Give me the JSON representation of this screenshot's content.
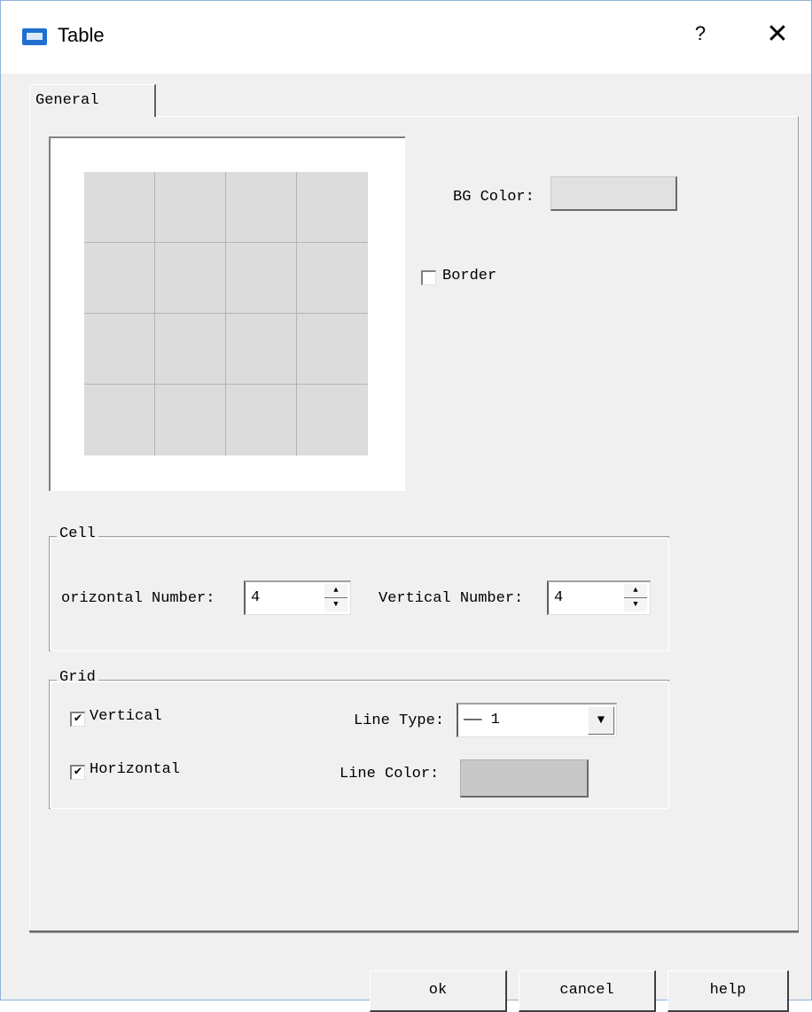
{
  "window": {
    "title": "Table",
    "help_label": "?",
    "close_label": "✕"
  },
  "tabs": [
    {
      "label": "General"
    }
  ],
  "general": {
    "bg_color_label": "BG Color:",
    "bg_color_value": "#e1e1e1",
    "border_label": "Border",
    "border_checked": false
  },
  "preview": {
    "rows": 4,
    "cols": 4,
    "fill_color": "#dcdcdc",
    "line_color": "#b4b4b4"
  },
  "cell": {
    "legend": "Cell",
    "horizontal_label": "orizontal Number:",
    "horizontal_value": "4",
    "vertical_label": "Vertical Number:",
    "vertical_value": "4"
  },
  "grid": {
    "legend": "Grid",
    "vertical_label": "Vertical",
    "vertical_checked": true,
    "horizontal_label": "Horizontal",
    "horizontal_checked": true,
    "line_type_label": "Line Type:",
    "line_type_value": "—— 1",
    "line_color_label": "Line Color:",
    "line_color_value": "#c8c8c8"
  },
  "buttons": {
    "ok": "ok",
    "cancel": "cancel",
    "help": "help"
  }
}
